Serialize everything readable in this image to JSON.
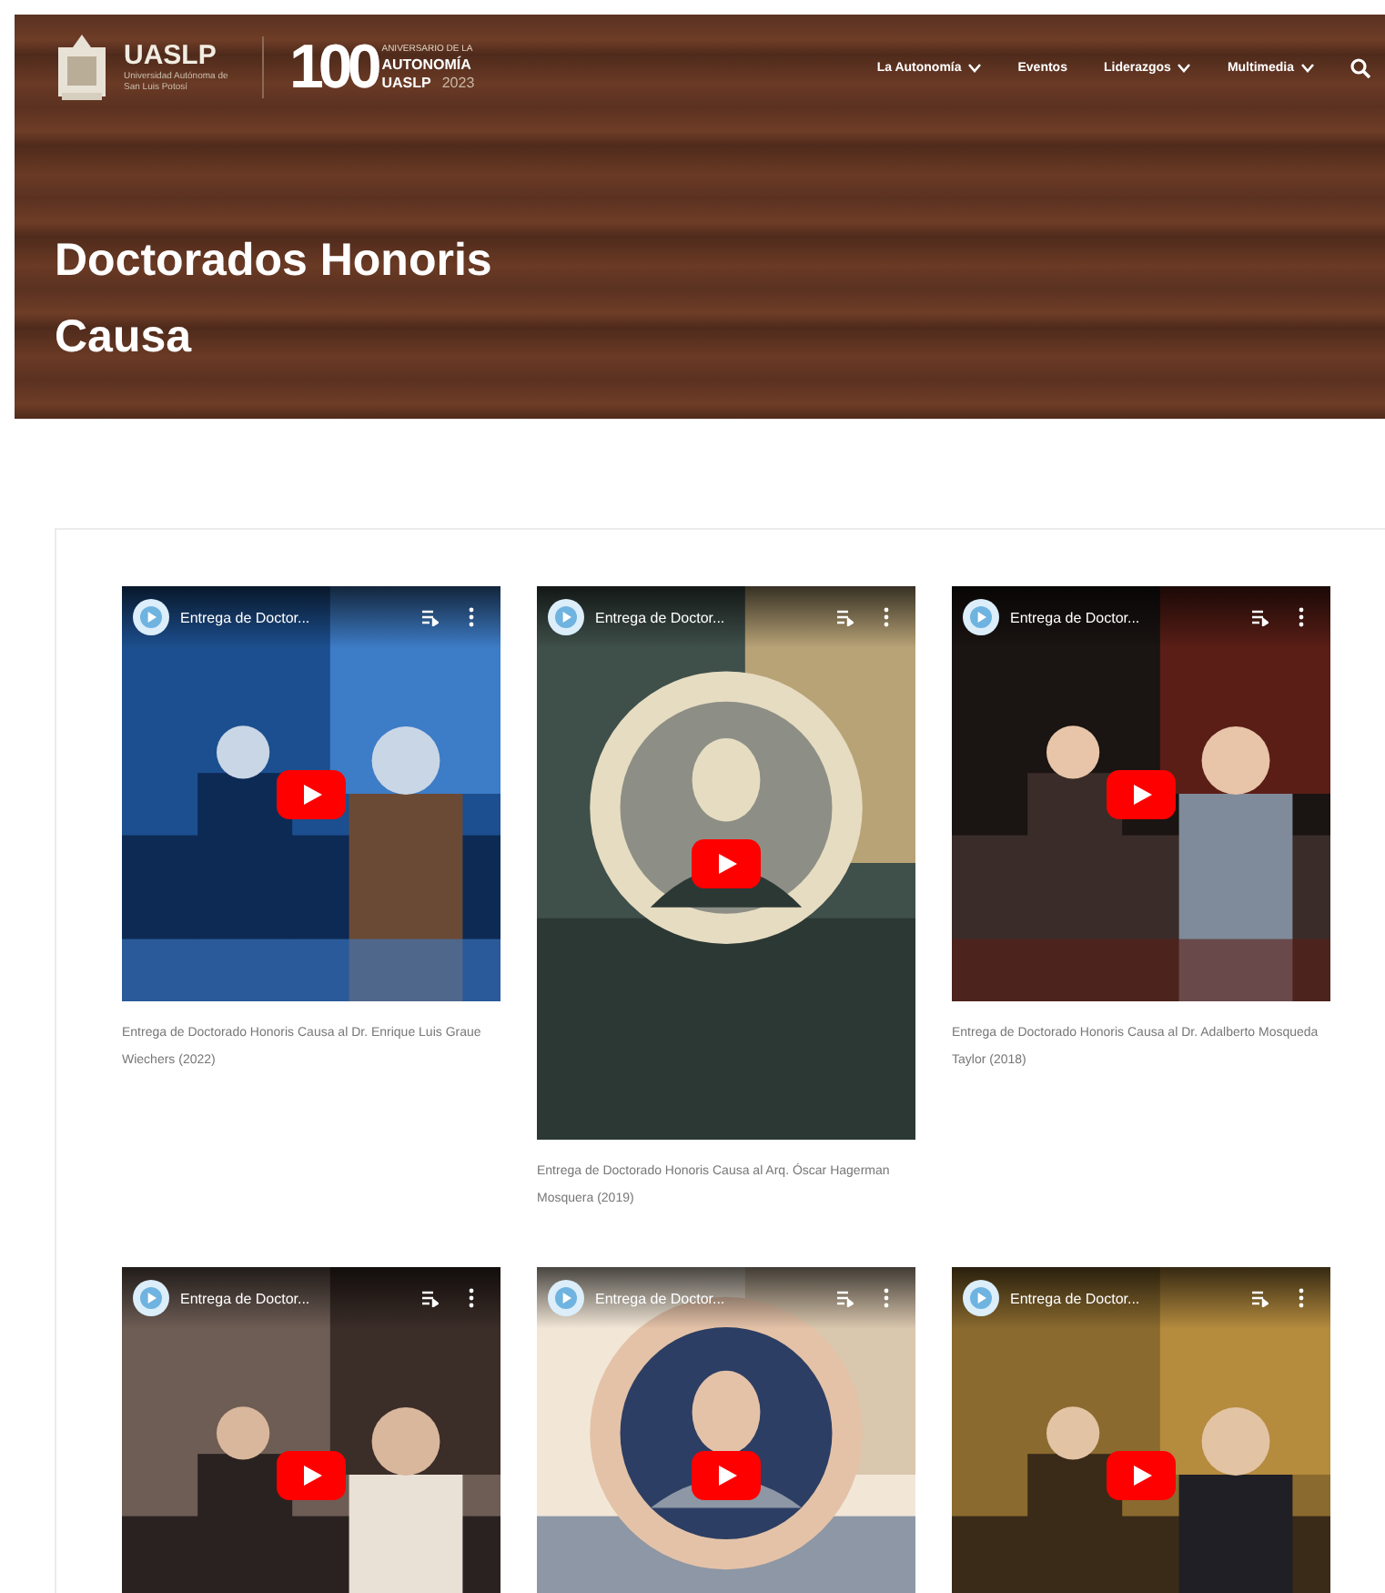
{
  "header": {
    "logo": {
      "name": "UASLP",
      "subtitle": "Universidad Autónoma de San Luis Potosí"
    },
    "anniversary": {
      "number": "100",
      "line1": "ANIVERSARIO DE LA",
      "line2": "AUTONOMÍA",
      "line3": "UASLP",
      "year": "2023"
    },
    "nav": [
      {
        "label": "La Autonomía",
        "dropdown": true
      },
      {
        "label": "Eventos",
        "dropdown": false
      },
      {
        "label": "Liderazgos",
        "dropdown": true
      },
      {
        "label": "Multimedia",
        "dropdown": true
      }
    ],
    "title": "Doctorados Honoris Causa"
  },
  "videos": [
    {
      "title": "Entrega de Doctor...",
      "kind": "wide",
      "caption": "Entrega de Doctorado Honoris Causa al Dr. Enrique Luis Graue Wiechers (2022)"
    },
    {
      "title": "Entrega de Doctor...",
      "kind": "tall",
      "caption": "Entrega de Doctorado Honoris Causa al Arq. Óscar Hagerman Mosquera (2019)"
    },
    {
      "title": "Entrega de Doctor...",
      "kind": "wide",
      "caption": "Entrega de Doctorado Honoris Causa al Dr. Adalberto Mosqueda Taylor (2018)"
    },
    {
      "title": "Entrega de Doctor...",
      "kind": "wide"
    },
    {
      "title": "Entrega de Doctor...",
      "kind": "wide"
    },
    {
      "title": "Entrega de Doctor...",
      "kind": "wide"
    }
  ]
}
